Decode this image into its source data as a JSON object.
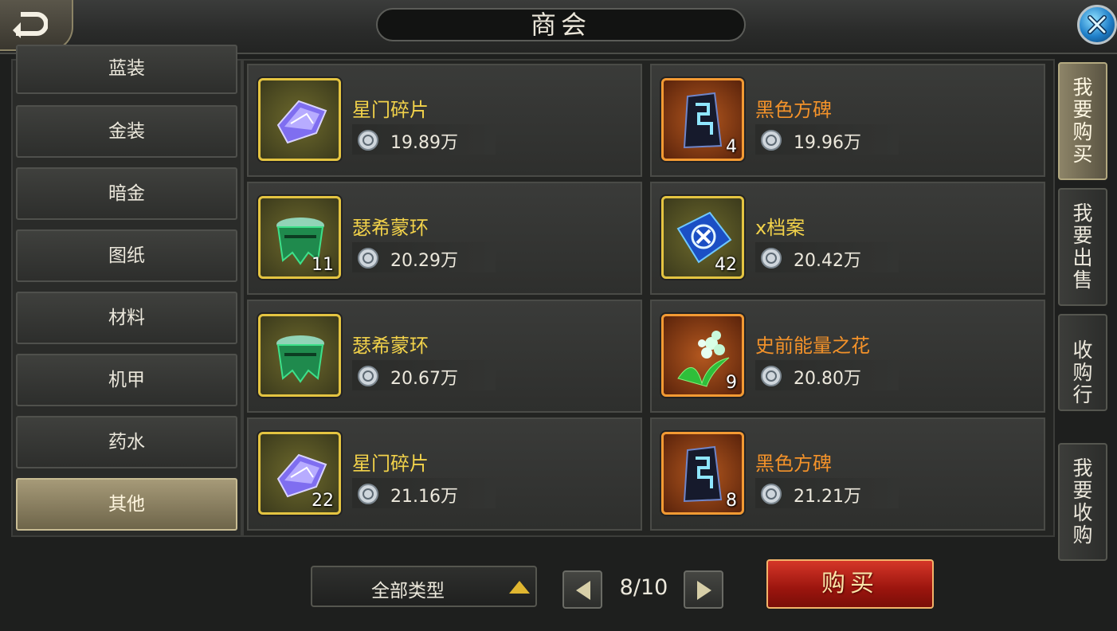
{
  "header": {
    "title": "商会"
  },
  "categories": [
    "蓝装",
    "金装",
    "暗金",
    "图纸",
    "材料",
    "机甲",
    "药水",
    "其他"
  ],
  "active_category": "其他",
  "right_tabs": [
    "我要购买",
    "我要出售",
    "收购行",
    "我要收购"
  ],
  "active_right_tab": "我要购买",
  "items": [
    {
      "name": "星门碎片",
      "price": "19.89万",
      "qty": "",
      "rarity": "gold",
      "icon": "crystal-shard-icon"
    },
    {
      "name": "黑色方碑",
      "price": "19.96万",
      "qty": "4",
      "rarity": "orange",
      "icon": "black-monolith-icon"
    },
    {
      "name": "瑟希蒙环",
      "price": "20.29万",
      "qty": "11",
      "rarity": "gold",
      "icon": "jade-ring-icon"
    },
    {
      "name": "x档案",
      "price": "20.42万",
      "qty": "42",
      "rarity": "gold",
      "icon": "x-file-icon"
    },
    {
      "name": "瑟希蒙环",
      "price": "20.67万",
      "qty": "",
      "rarity": "gold",
      "icon": "jade-ring-icon"
    },
    {
      "name": "史前能量之花",
      "price": "20.80万",
      "qty": "9",
      "rarity": "orange",
      "icon": "energy-flower-icon"
    },
    {
      "name": "星门碎片",
      "price": "21.16万",
      "qty": "22",
      "rarity": "gold",
      "icon": "crystal-shard-icon"
    },
    {
      "name": "黑色方碑",
      "price": "21.21万",
      "qty": "8",
      "rarity": "orange",
      "icon": "black-monolith-icon"
    }
  ],
  "filter": {
    "label": "全部类型"
  },
  "pagination": {
    "text": "8/10",
    "current": 8,
    "total": 10
  },
  "buy_button": {
    "label": "购买"
  },
  "colors": {
    "gold_name": "#f2d24a",
    "orange_name": "#f3922a",
    "buy_red": "#b51d13"
  }
}
